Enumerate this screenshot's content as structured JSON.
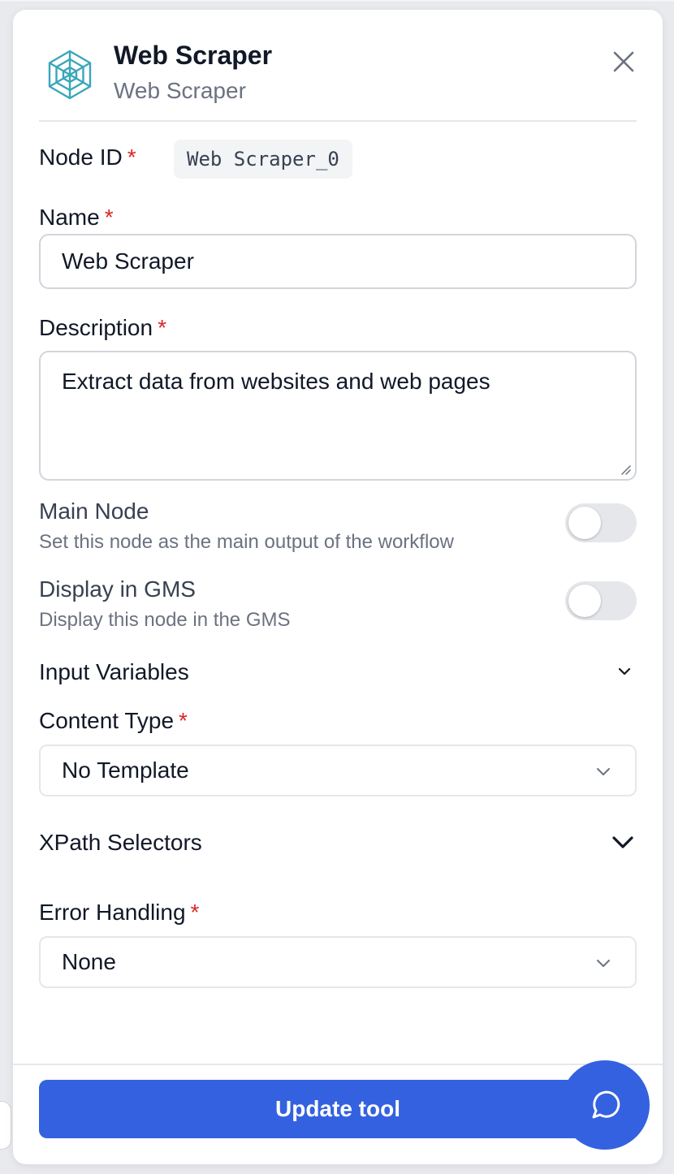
{
  "header": {
    "title": "Web Scraper",
    "subtitle": "Web Scraper",
    "logo_icon": "spider-web-icon",
    "close_icon": "close-icon"
  },
  "node_id": {
    "label": "Node ID",
    "required_mark": "*",
    "value": "Web Scraper_0"
  },
  "name": {
    "label": "Name",
    "required_mark": "*",
    "value": "Web Scraper"
  },
  "description": {
    "label": "Description",
    "required_mark": "*",
    "value": "Extract data from websites and web pages"
  },
  "main_node": {
    "title": "Main Node",
    "description": "Set this node as the main output of the workflow",
    "enabled": false
  },
  "display_in_gms": {
    "title": "Display in GMS",
    "description": "Display this node in the GMS",
    "enabled": false
  },
  "input_variables": {
    "label": "Input Variables",
    "icon": "chevron-down-icon"
  },
  "content_type": {
    "label": "Content Type",
    "required_mark": "*",
    "selected": "No Template"
  },
  "xpath_selectors": {
    "label": "XPath Selectors",
    "icon": "chevron-down-icon"
  },
  "error_handling": {
    "label": "Error Handling",
    "required_mark": "*",
    "selected": "None"
  },
  "footer": {
    "update_button": "Update tool",
    "chat_icon": "chat-bubble-icon"
  },
  "colors": {
    "accent": "#3461e0",
    "required": "#dc2626",
    "logo": "#3aa6b9"
  }
}
